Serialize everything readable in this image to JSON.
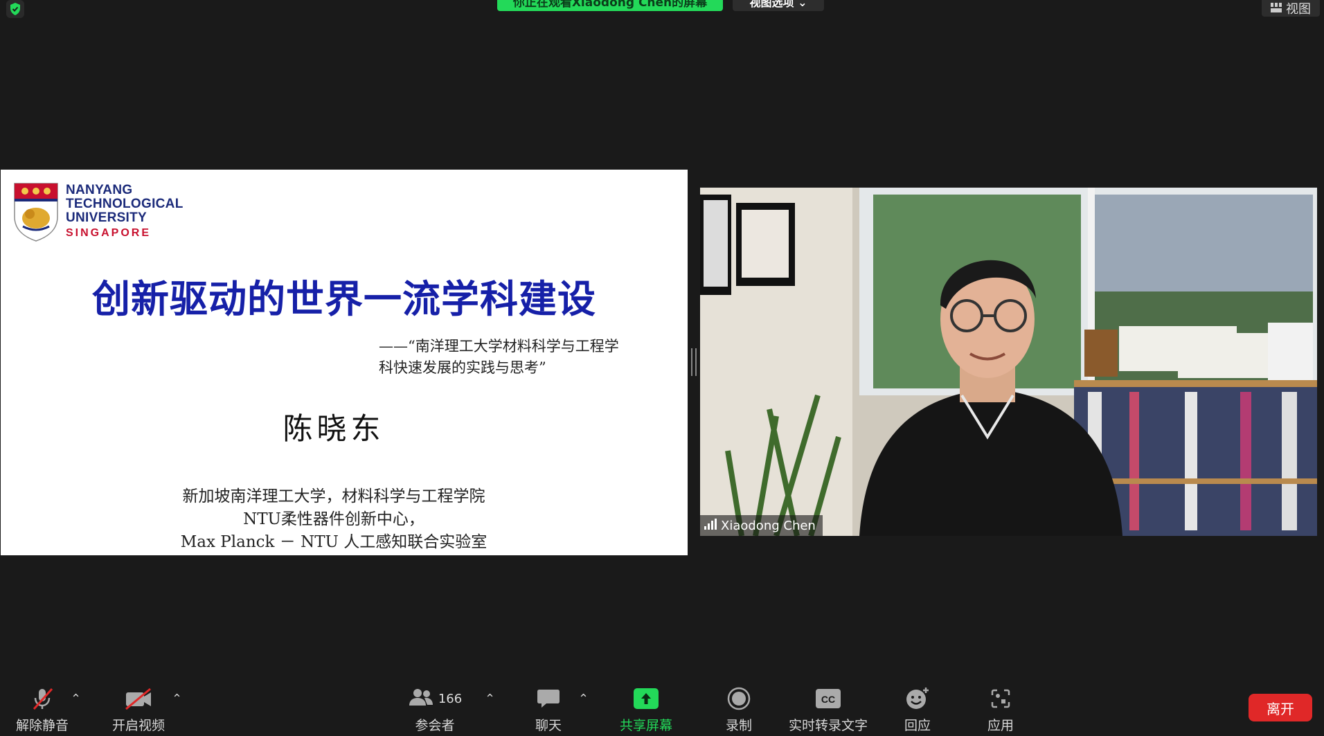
{
  "top_bar": {
    "share_banner": "你正在观看Xiaodong Chen的屏幕",
    "view_options": "视图选项 ⌄",
    "view_button": "视图"
  },
  "slide": {
    "logo_lines": [
      "NANYANG",
      "TECHNOLOGICAL",
      "UNIVERSITY"
    ],
    "logo_sub": "SINGAPORE",
    "title": "创新驱动的世界一流学科建设",
    "subtitle_line1": "——“南洋理工大学材料科学与工程学",
    "subtitle_line2": "科快速发展的实践与思考”",
    "author": "陈晓东",
    "affiliation_line1": "新加坡南洋理工大学，材料科学与工程学院",
    "affiliation_line2": "NTU柔性器件创新中心，",
    "affiliation_line3": "Max Planck － NTU 人工感知联合实验室"
  },
  "video": {
    "participant_name": "Xiaodong Chen"
  },
  "toolbar": {
    "unmute_label": "解除静音",
    "start_video_label": "开启视频",
    "participants_label": "参会者",
    "participants_count": "166",
    "chat_label": "聊天",
    "share_label": "共享屏幕",
    "record_label": "录制",
    "captions_label": "实时转录文字",
    "captions_icon_text": "CC",
    "reactions_label": "回应",
    "apps_label": "应用",
    "leave_label": "离开"
  },
  "colors": {
    "accent_green": "#23d959",
    "leave_red": "#e02828",
    "slide_title_blue": "#1620a8",
    "ntu_navy": "#1b2a7a",
    "ntu_red": "#c8102e"
  }
}
